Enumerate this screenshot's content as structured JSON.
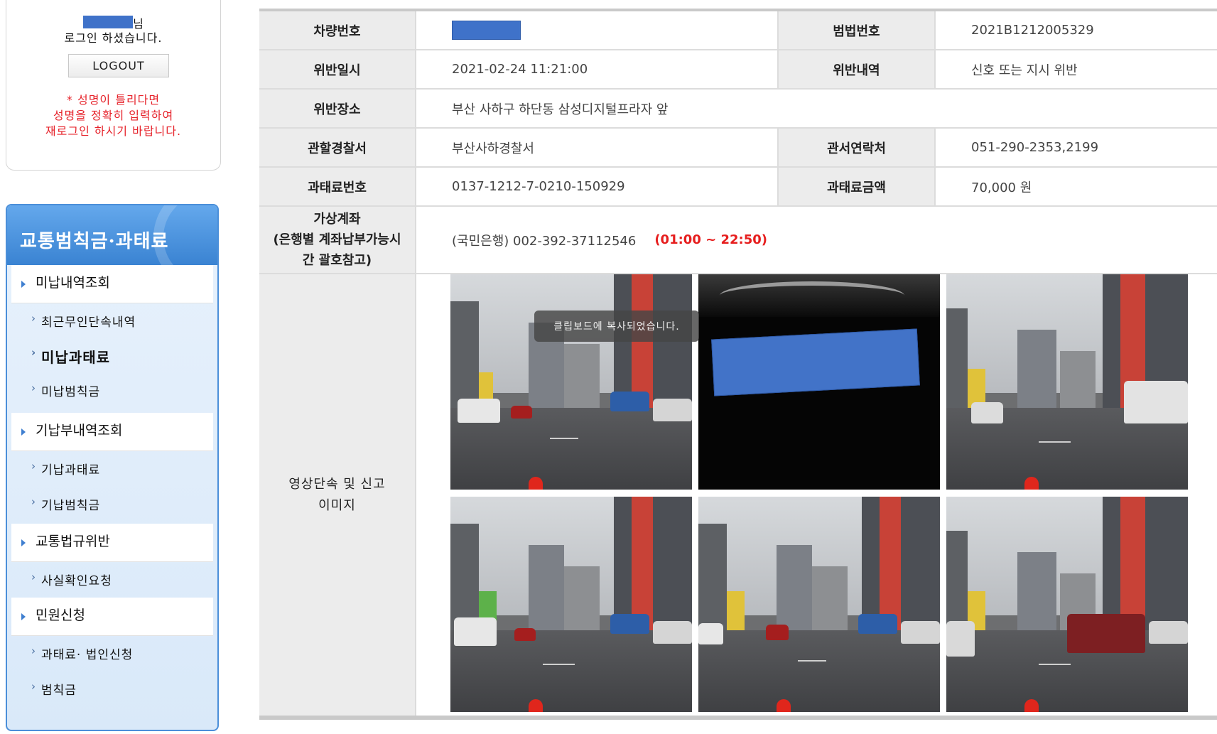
{
  "login": {
    "user_suffix": "님",
    "message": "로그인 하셨습니다.",
    "logout_label": "LOGOUT",
    "warning_line1": "* 성명이 틀리다면",
    "warning_line2": "성명을 정확히 입력하여",
    "warning_line3": "재로그인 하시기 바랍니다."
  },
  "menu": {
    "title": "교통범칙금·과태료",
    "items": [
      {
        "type": "category",
        "label": "미납내역조회"
      },
      {
        "type": "sub",
        "label": "최근무인단속내역"
      },
      {
        "type": "sub",
        "label": "미납과태료",
        "active": true
      },
      {
        "type": "sub",
        "label": "미납범칙금"
      },
      {
        "type": "category",
        "label": "기납부내역조회"
      },
      {
        "type": "sub",
        "label": "기납과태료"
      },
      {
        "type": "sub",
        "label": "기납범칙금"
      },
      {
        "type": "category",
        "label": "교통법규위반"
      },
      {
        "type": "sub",
        "label": "사실확인요청"
      },
      {
        "type": "category",
        "label": "민원신청"
      },
      {
        "type": "sub",
        "label": "과태료· 법인신청"
      },
      {
        "type": "sub",
        "label": "범칙금"
      }
    ]
  },
  "detail": {
    "vehicle_label": "차량번호",
    "case_label": "범법번호",
    "case_value": "2021B1212005329",
    "datetime_label": "위반일시",
    "datetime_value": "2021-02-24 11:21:00",
    "violation_label": "위반내역",
    "violation_value": "신호 또는 지시 위반",
    "location_label": "위반장소",
    "location_value": "부산 사하구 하단동 삼성디지털프라자 앞",
    "station_label": "관할경찰서",
    "station_value": "부산사하경찰서",
    "contact_label": "관서연락처",
    "contact_value": "051-290-2353,2199",
    "fine_no_label": "과태료번호",
    "fine_no_value": "0137-1212-7-0210-150929",
    "amount_label": "과태료금액",
    "amount_value": "70,000 원",
    "account_label_1": "가상계좌",
    "account_label_2": "(은행별 계좌납부가능시",
    "account_label_3": "간 괄호참고)",
    "account_value": "(국민은행) 002-392-37112546",
    "account_hours": "(01:00 ~ 22:50)",
    "images_label_1": "영상단속 및 신고",
    "images_label_2": "이미지"
  },
  "toast": "클립보드에 복사되었습니다.",
  "colors": {
    "menu_accent": "#3a83d2",
    "warning": "#e6222a",
    "hours": "#e61e1e",
    "redaction": "#3f72c9"
  }
}
